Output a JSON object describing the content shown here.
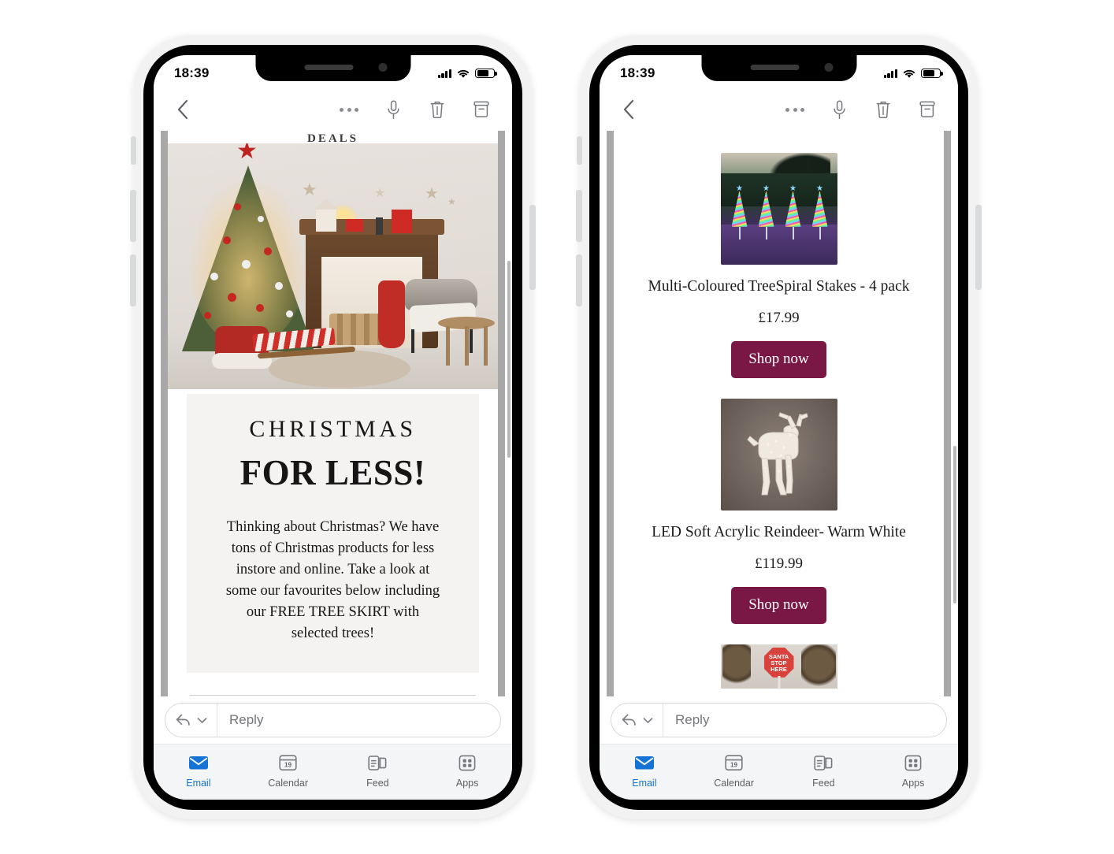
{
  "device": {
    "status_bar": {
      "time": "18:39",
      "signal": "signal-bars-icon",
      "wifi": "wifi-icon",
      "battery": "battery-icon"
    },
    "home_indicator": "home-indicator"
  },
  "toolbar": {
    "back": "back-chevron-icon",
    "more": "more-options-icon",
    "dictate": "microphone-icon",
    "delete": "trash-icon",
    "archive": "archive-icon"
  },
  "reply": {
    "placeholder": "Reply",
    "reply_icon": "reply-arrow-icon",
    "chevron": "chevron-down-icon"
  },
  "tabbar": {
    "items": [
      {
        "label": "Email",
        "icon": "envelope-icon",
        "active": true
      },
      {
        "label": "Calendar",
        "icon": "calendar-icon",
        "day": "19",
        "active": false
      },
      {
        "label": "Feed",
        "icon": "feed-icon",
        "active": false
      },
      {
        "label": "Apps",
        "icon": "apps-grid-icon",
        "active": false
      }
    ]
  },
  "phone_left": {
    "clipped_header": "DEALS",
    "hero_image": "christmas-living-room-photo",
    "promo": {
      "eyebrow": "CHRISTMAS",
      "headline": "FOR LESS!",
      "body": "Thinking about Christmas? We have tons of Christmas products for less instore and online. Take  a look at some our favourites below including our FREE TREE SKIRT with selected trees!"
    }
  },
  "phone_right": {
    "products": [
      {
        "image": "multicoloured-tree-spiral-stakes-photo",
        "title": "Multi-Coloured TreeSpiral Stakes - 4 pack",
        "price": "£17.99",
        "cta": "Shop now"
      },
      {
        "image": "led-soft-acrylic-reindeer-photo",
        "title": "LED Soft Acrylic Reindeer- Warm White",
        "price": "£119.99",
        "cta": "Shop now"
      },
      {
        "image": "santa-stop-here-sign-photo",
        "title": "",
        "price": "",
        "cta": ""
      }
    ]
  },
  "colors": {
    "cta_background": "#7a1845",
    "cta_text": "#ffffff",
    "active_tab": "#1573d6",
    "panel_background": "#f4f3f1",
    "tabbar_background": "#f4f5f6"
  }
}
